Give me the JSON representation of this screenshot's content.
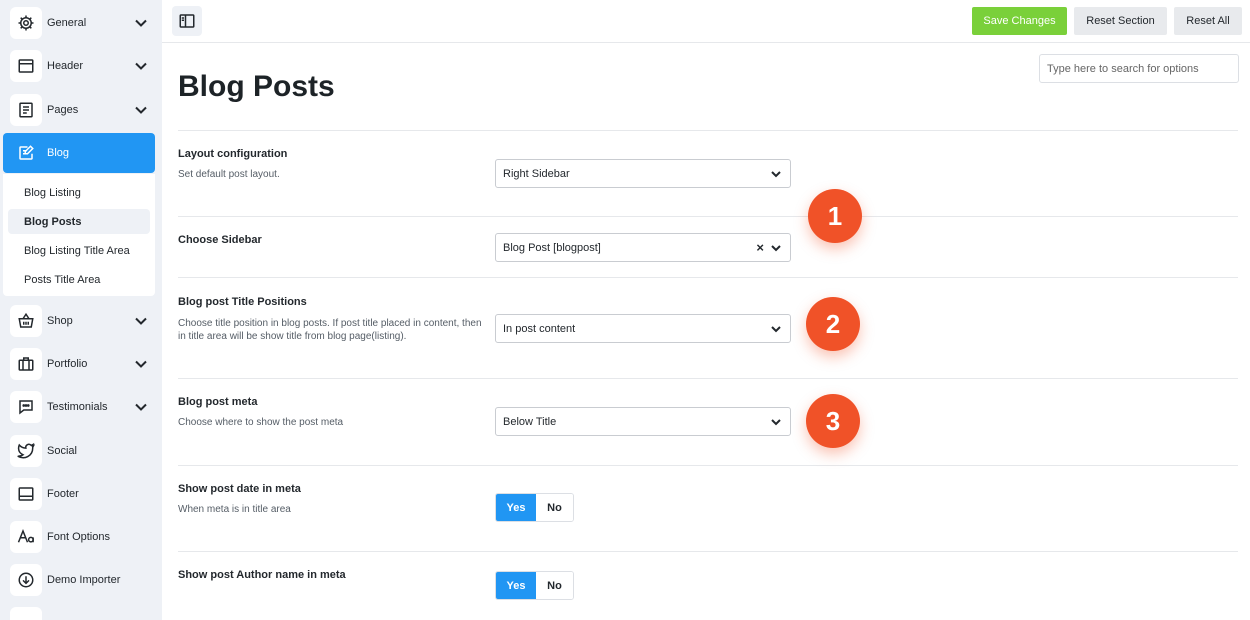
{
  "sidebar": {
    "items": [
      {
        "label": "General",
        "icon": "gear-icon",
        "has_children": true
      },
      {
        "label": "Header",
        "icon": "window-icon",
        "has_children": true
      },
      {
        "label": "Pages",
        "icon": "pages-icon",
        "has_children": true
      },
      {
        "label": "Blog",
        "icon": "edit-icon",
        "active": true
      },
      {
        "label": "Shop",
        "icon": "basket-icon",
        "has_children": true
      },
      {
        "label": "Portfolio",
        "icon": "briefcase-icon",
        "has_children": true
      },
      {
        "label": "Testimonials",
        "icon": "chat-icon",
        "has_children": true
      },
      {
        "label": "Social",
        "icon": "twitter-icon"
      },
      {
        "label": "Footer",
        "icon": "footer-icon"
      },
      {
        "label": "Font Options",
        "icon": "font-icon"
      },
      {
        "label": "Demo Importer",
        "icon": "download-icon"
      }
    ],
    "blog_sub": [
      {
        "label": "Blog Listing"
      },
      {
        "label": "Blog Posts",
        "active": true
      },
      {
        "label": "Blog Listing Title Area"
      },
      {
        "label": "Posts Title Area"
      }
    ]
  },
  "toolbar": {
    "save_label": "Save Changes",
    "reset_section_label": "Reset Section",
    "reset_all_label": "Reset All"
  },
  "search": {
    "placeholder": "Type here to search for options"
  },
  "page": {
    "title": "Blog Posts"
  },
  "options": {
    "layout": {
      "title": "Layout configuration",
      "desc": "Set default post layout.",
      "value": "Right Sidebar"
    },
    "sidebar": {
      "title": "Choose Sidebar",
      "value": "Blog Post [blogpost]",
      "clear": "×"
    },
    "title_pos": {
      "title": "Blog post Title Positions",
      "desc": "Choose title position in blog posts. If post title placed in content, then in title area will be show title from blog page(listing).",
      "value": "In post content"
    },
    "meta": {
      "title": "Blog post meta",
      "desc": "Choose where to show the post meta",
      "value": "Below Title"
    },
    "date_meta": {
      "title": "Show post date in meta",
      "desc": "When meta is in title area",
      "yes": "Yes",
      "no": "No",
      "selected": "Yes"
    },
    "author_meta": {
      "title": "Show post Author name in meta",
      "yes": "Yes",
      "no": "No",
      "selected": "Yes"
    }
  },
  "badges": [
    "1",
    "2",
    "3"
  ],
  "colors": {
    "accent": "#2196f3",
    "save": "#7ad03a",
    "badge": "#f05228",
    "sidebar_bg": "#eef1f6"
  }
}
